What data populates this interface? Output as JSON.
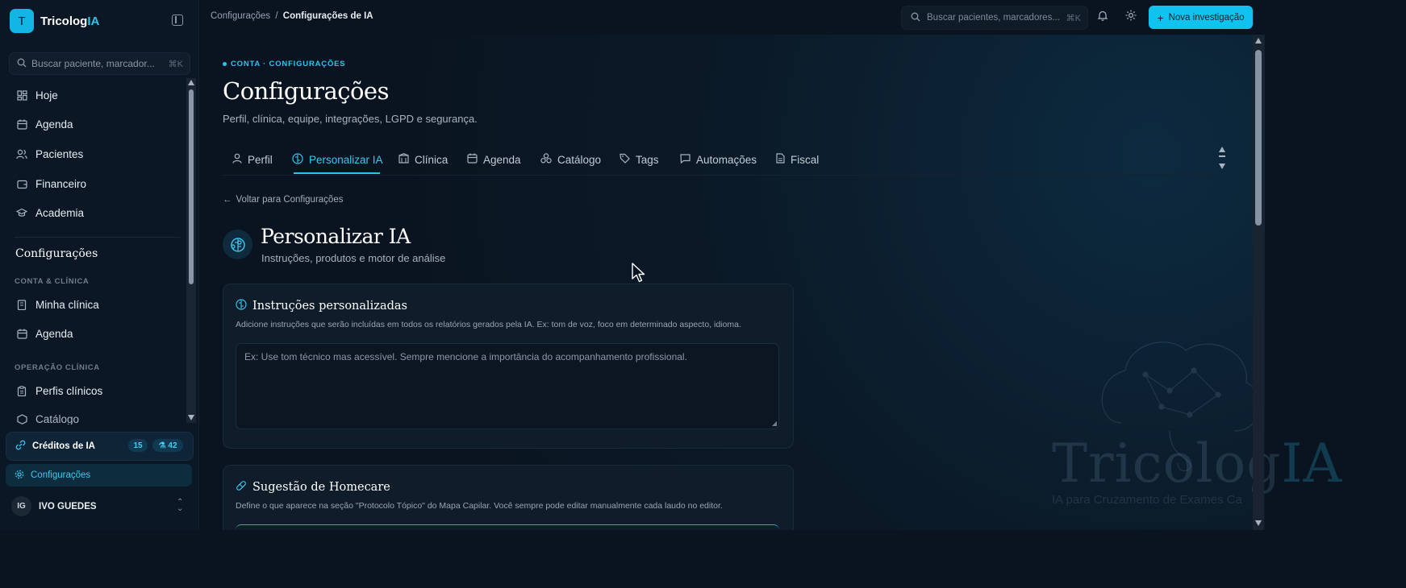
{
  "app": {
    "logo_letter": "T",
    "name_part1": "Tricolog",
    "name_part2": "IA"
  },
  "sidebar": {
    "search_placeholder": "Buscar paciente, marcador...",
    "search_kbd": "⌘K",
    "nav": [
      {
        "label": "Hoje",
        "icon": "grid-icon"
      },
      {
        "label": "Agenda",
        "icon": "calendar-icon"
      },
      {
        "label": "Pacientes",
        "icon": "users-icon"
      },
      {
        "label": "Financeiro",
        "icon": "wallet-icon"
      },
      {
        "label": "Academia",
        "icon": "graduation-cap-icon"
      }
    ],
    "settings_heading": "Configurações",
    "section_account": "CONTA & CLÍNICA",
    "account_items": [
      {
        "label": "Minha clínica",
        "icon": "building-icon"
      },
      {
        "label": "Agenda",
        "icon": "calendar-icon"
      }
    ],
    "section_operation": "OPERAÇÃO CLÍNICA",
    "operation_items": [
      {
        "label": "Perfis clínicos",
        "icon": "clipboard-icon"
      },
      {
        "label": "Catálogo",
        "icon": "box-icon"
      }
    ],
    "credits": {
      "label": "Créditos de IA",
      "count_a": "15",
      "count_b": "42"
    },
    "config_item": "Configurações",
    "user": {
      "initials": "IG",
      "name": "IVO GUEDES"
    }
  },
  "topbar": {
    "breadcrumb_parent": "Configurações",
    "breadcrumb_sep": "/",
    "breadcrumb_current": "Configurações de IA",
    "search_placeholder": "Buscar pacientes, marcadores...",
    "search_kbd": "⌘K",
    "new_button": "Nova investigação"
  },
  "page": {
    "kicker": "CONTA · CONFIGURAÇÕES",
    "title": "Configurações",
    "subtitle": "Perfil, clínica, equipe, integrações, LGPD e segurança.",
    "tabs": [
      {
        "label": "Perfil",
        "icon": "user-icon"
      },
      {
        "label": "Personalizar IA",
        "icon": "brain-icon",
        "active": true
      },
      {
        "label": "Clínica",
        "icon": "hospital-icon"
      },
      {
        "label": "Agenda",
        "icon": "calendar-icon"
      },
      {
        "label": "Catálogo",
        "icon": "cubes-icon"
      },
      {
        "label": "Tags",
        "icon": "tag-icon"
      },
      {
        "label": "Automações",
        "icon": "message-icon"
      },
      {
        "label": "Fiscal",
        "icon": "file-icon"
      }
    ],
    "back_link": "Voltar para Configurações",
    "section_title": "Personalizar IA",
    "section_subtitle": "Instruções, produtos e motor de análise"
  },
  "cards": {
    "instructions": {
      "title": "Instruções personalizadas",
      "description": "Adicione instruções que serão incluídas em todos os relatórios gerados pela IA. Ex: tom de voz, foco em determinado aspecto, idioma.",
      "placeholder": "Ex: Use tom técnico mas acessível. Sempre mencione a importância do acompanhamento profissional."
    },
    "homecare": {
      "title": "Sugestão de Homecare",
      "description": "Define o que aparece na seção \"Protocolo Tópico\" do Mapa Capilar. Você sempre pode editar manualmente cada laudo no editor."
    }
  },
  "watermark": {
    "name_part1": "Tricolog",
    "name_part2": "IA",
    "tagline": "IA para Cruzamento de Exames Ca"
  },
  "colors": {
    "accent": "#10c3ef",
    "background": "#0a1420",
    "panel": "#0f1c2a"
  }
}
